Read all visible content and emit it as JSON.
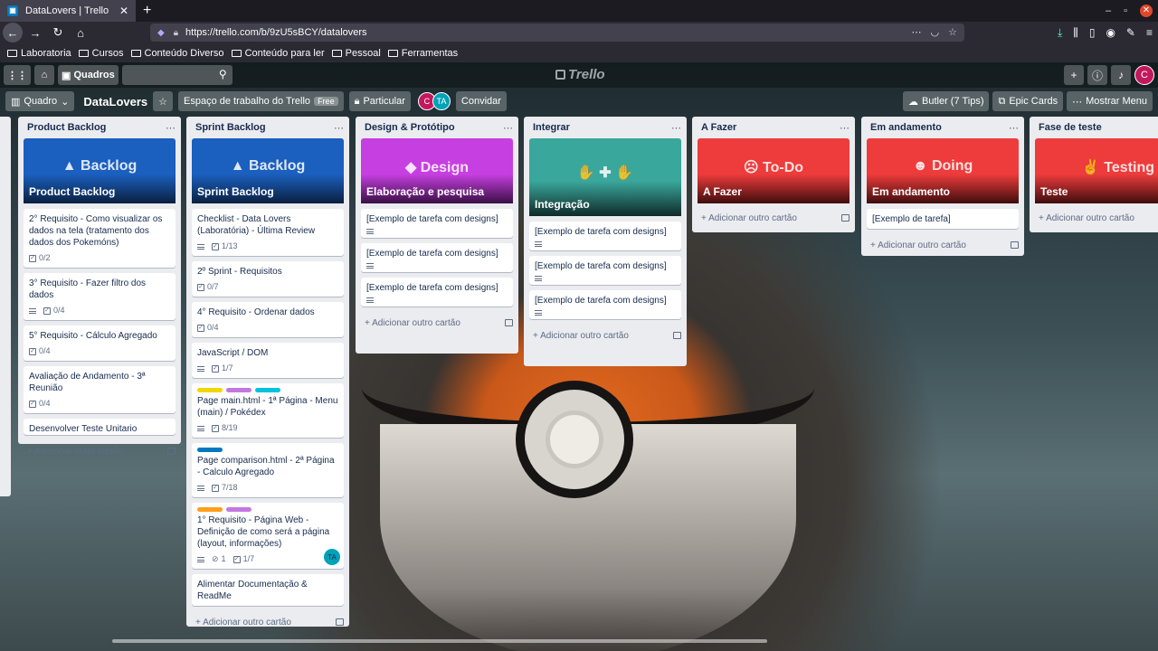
{
  "browser": {
    "tab_title": "DataLovers | Trello",
    "url": "https://trello.com/b/9zU5sBCY/datalovers",
    "bookmarks": [
      "Laboratoria",
      "Cursos",
      "Conteúdo Diverso",
      "Conteúdo para ler",
      "Pessoal",
      "Ferramentas"
    ]
  },
  "header": {
    "boards_label": "Quadros",
    "logo": "Trello",
    "avatar_initial": "C"
  },
  "board": {
    "view_label": "Quadro",
    "name": "DataLovers",
    "workspace_label": "Espaço de trabalho do Trello",
    "free_badge": "Free",
    "visibility_label": "Particular",
    "member1": "C",
    "member2": "TA",
    "invite_label": "Convidar",
    "butler_label": "Butler (7 Tips)",
    "epic_label": "Epic Cards",
    "menu_label": "Mostrar Menu"
  },
  "add_card_label": "Adicionar outro cartão",
  "lists": [
    {
      "title": "Product Backlog",
      "cover": {
        "big": "Backlog",
        "label": "Product Backlog",
        "color": "#1b5fbf"
      },
      "cards": [
        {
          "text": "2° Requisito - Como visualizar os dados na tela (tratamento dos dados dos Pokemóns)",
          "check": "0/2"
        },
        {
          "text": "3° Requisito - Fazer filtro dos dados",
          "check": "0/4"
        },
        {
          "text": "5° Requisito - Cálculo Agregado",
          "check": "0/4"
        },
        {
          "text": "Avaliação de Andamento - 3ª Reunião",
          "check": "0/4"
        },
        {
          "text": "Desenvolver Teste Unitario"
        }
      ]
    },
    {
      "title": "Sprint Backlog",
      "cover": {
        "big": "Backlog",
        "label": "Sprint Backlog",
        "color": "#1b5fbf"
      },
      "cards": [
        {
          "text": "Checklist - Data Lovers (Laboratória) - Última Review",
          "check": "1/13"
        },
        {
          "text": "2º Sprint - Requisitos",
          "check": "0/7"
        },
        {
          "text": "4° Requisito - Ordenar dados",
          "check": "0/4"
        },
        {
          "text": "JavaScript / DOM",
          "check": "1/7"
        },
        {
          "text": "Page main.html - 1ª Página - Menu (main) / Pokédex",
          "check": "8/19"
        },
        {
          "text": "Page comparison.html - 2ª Página - Calculo Agregado",
          "check": "7/18"
        },
        {
          "text": "1° Requisito - Página Web - Definição de como será a página (layout, informações)",
          "attach": "1",
          "check": "1/7",
          "member": "TA"
        },
        {
          "text": "Alimentar Documentação & ReadMe"
        }
      ]
    },
    {
      "title": "Design & Protótipo",
      "cover": {
        "big": "Design",
        "label": "Elaboração e pesquisa",
        "color": "#b93fd6"
      },
      "cards": [
        {
          "text": "[Exemplo de tarefa com designs]"
        },
        {
          "text": "[Exemplo de tarefa com designs]"
        },
        {
          "text": "[Exemplo de tarefa com designs]"
        }
      ]
    },
    {
      "title": "Integrar",
      "cover": {
        "label": "Integração",
        "color": "#2f9e95"
      },
      "cards": [
        {
          "text": "[Exemplo de tarefa com designs]"
        },
        {
          "text": "[Exemplo de tarefa com designs]"
        },
        {
          "text": "[Exemplo de tarefa com designs]"
        }
      ]
    },
    {
      "title": "A Fazer",
      "cover": {
        "big": "To-Do",
        "label": "A Fazer",
        "color": "#e53935"
      },
      "cards": []
    },
    {
      "title": "Em andamento",
      "cover": {
        "big": "Doing",
        "label": "Em andamento",
        "color": "#e53935"
      },
      "cards": [
        {
          "text": "[Exemplo de tarefa]"
        }
      ]
    },
    {
      "title": "Fase de teste",
      "cover": {
        "big": "Testing",
        "label": "Teste",
        "color": "#e53935"
      },
      "cards": []
    }
  ],
  "colors": {
    "label_yellow": "#f2d600",
    "label_purple": "#c377e0",
    "label_sky": "#00c2e0",
    "label_blue": "#0079bf",
    "label_orange": "#ff9f1a"
  }
}
